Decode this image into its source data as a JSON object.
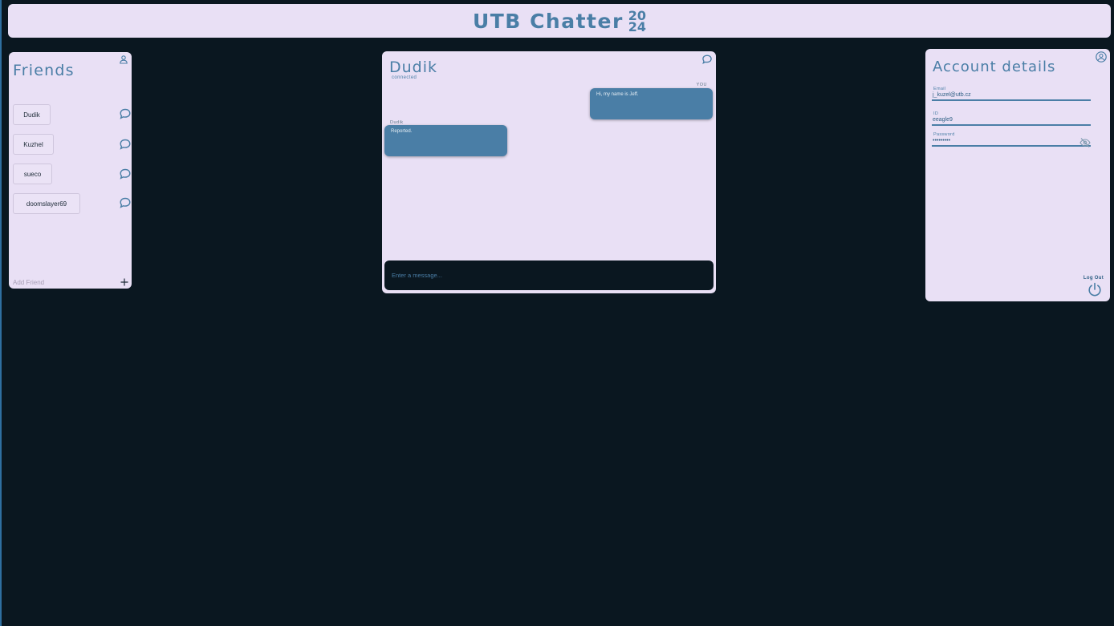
{
  "header": {
    "title": "UTB Chatter",
    "year_top": "20",
    "year_bottom": "24"
  },
  "friends": {
    "title": "Friends",
    "items": [
      {
        "name": "Dudik"
      },
      {
        "name": "Kuzhel"
      },
      {
        "name": "sueco"
      },
      {
        "name": "doomslayer69"
      }
    ],
    "add_placeholder": "Add Friend"
  },
  "chat": {
    "contact_name": "Dudik",
    "status": "connected",
    "messages": [
      {
        "sender": "YOU",
        "text": "Hi, my name is Jeff."
      },
      {
        "sender": "Dudik",
        "text": "Reported."
      }
    ],
    "input_placeholder": "Enter a message..."
  },
  "account": {
    "title": "Account details",
    "email_label": "Email",
    "email_value": "j_kuzel@utb.cz",
    "id_label": "ID",
    "id_value": "eeagle9",
    "password_label": "Password",
    "password_value": "•••••••••",
    "logout_label": "Log Out"
  },
  "colors": {
    "background": "#0a1720",
    "panel": "#e9e0f5",
    "accent": "#4a7ea6"
  },
  "icons": [
    "person-icon",
    "chat-bubble-icon",
    "plus-icon",
    "account-circle-icon",
    "eye-off-icon",
    "power-icon"
  ]
}
